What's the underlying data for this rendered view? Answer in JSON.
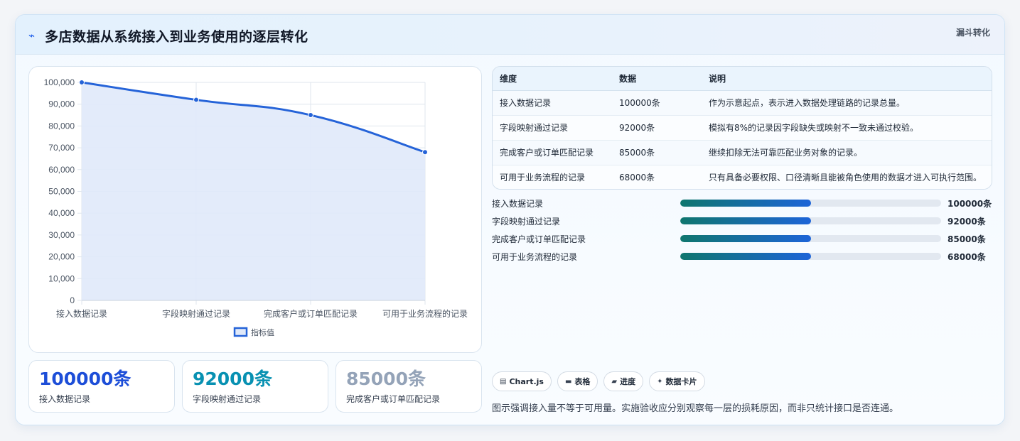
{
  "header": {
    "icon": "chart-trend-icon",
    "title": "多店数据从系统接入到业务使用的逐层转化",
    "tag": "漏斗转化"
  },
  "chart_data": {
    "type": "area",
    "categories": [
      "接入数据记录",
      "字段映射通过记录",
      "完成客户或订单匹配记录",
      "可用于业务流程的记录"
    ],
    "series": [
      {
        "name": "指标值",
        "values": [
          100000,
          92000,
          85000,
          68000
        ]
      }
    ],
    "y_ticks": [
      "100,000",
      "90,000",
      "80,000",
      "70,000",
      "60,000",
      "50,000",
      "40,000",
      "30,000",
      "20,000",
      "10,000",
      "0"
    ],
    "ylim": [
      0,
      100000
    ],
    "grid": true,
    "legend_position": "bottom",
    "line_color": "#2563d8",
    "fill_color": "#e0e9f9"
  },
  "stats": [
    {
      "value": "100000条",
      "label": "接入数据记录"
    },
    {
      "value": "92000条",
      "label": "字段映射通过记录"
    },
    {
      "value": "85000条",
      "label": "完成客户或订单匹配记录"
    }
  ],
  "table": {
    "headers": [
      "维度",
      "数据",
      "说明"
    ],
    "rows": [
      [
        "接入数据记录",
        "100000条",
        "作为示意起点，表示进入数据处理链路的记录总量。"
      ],
      [
        "字段映射通过记录",
        "92000条",
        "模拟有8%的记录因字段缺失或映射不一致未通过校验。"
      ],
      [
        "完成客户或订单匹配记录",
        "85000条",
        "继续扣除无法可靠匹配业务对象的记录。"
      ],
      [
        "可用于业务流程的记录",
        "68000条",
        "只有具备必要权限、口径清晰且能被角色使用的数据才进入可执行范围。"
      ]
    ]
  },
  "progress": [
    {
      "label": "接入数据记录",
      "value": "100000条",
      "fill_fraction": 0.5
    },
    {
      "label": "字段映射通过记录",
      "value": "92000条",
      "fill_fraction": 0.5
    },
    {
      "label": "完成客户或订单匹配记录",
      "value": "85000条",
      "fill_fraction": 0.5
    },
    {
      "label": "可用于业务流程的记录",
      "value": "68000条",
      "fill_fraction": 0.5
    }
  ],
  "chips": [
    {
      "icon": "chart-icon",
      "glyph": "▤",
      "label": "Chart.js"
    },
    {
      "icon": "table-icon",
      "glyph": "▬",
      "label": "表格"
    },
    {
      "icon": "progress-icon",
      "glyph": "▰",
      "label": "进度"
    },
    {
      "icon": "sparkle-icon",
      "glyph": "✦",
      "label": "数据卡片"
    }
  ],
  "note": "图示强调接入量不等于可用量。实施验收应分别观察每一层的损耗原因，而非只统计接口是否连通。"
}
